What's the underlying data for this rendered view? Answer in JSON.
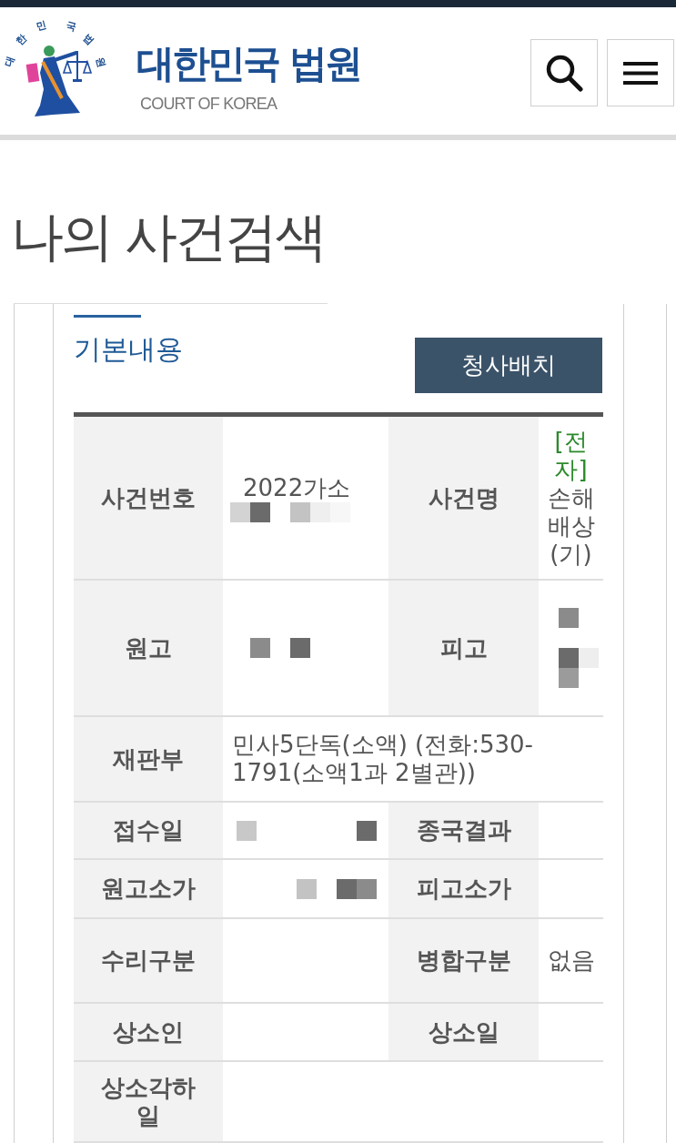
{
  "header": {
    "emblem_text": "대한민국법원",
    "title": "대한민국 법원",
    "subtitle": "COURT OF KOREA"
  },
  "page_title": "나의 사건검색",
  "section": {
    "title": "기본내용",
    "button": "청사배치"
  },
  "table": {
    "rows": [
      {
        "cells": [
          {
            "kind": "header",
            "text": "사건번호"
          },
          {
            "kind": "redacted",
            "text": "2022가소"
          },
          {
            "kind": "header",
            "text": "사건명"
          },
          {
            "kind": "value",
            "tag": "[전자]",
            "text": "손해배상(기)"
          }
        ]
      },
      {
        "cells": [
          {
            "kind": "header",
            "text": "원고"
          },
          {
            "kind": "redacted"
          },
          {
            "kind": "header",
            "text": "피고"
          },
          {
            "kind": "redacted"
          }
        ]
      },
      {
        "cells": [
          {
            "kind": "header",
            "text": "재판부"
          },
          {
            "kind": "value",
            "text": "민사5단독(소액) (전화:530-1791(소액1과 2별관))"
          }
        ]
      },
      {
        "cells": [
          {
            "kind": "header",
            "text": "접수일"
          },
          {
            "kind": "redacted"
          },
          {
            "kind": "header",
            "text": "종국결과"
          },
          {
            "kind": "value"
          }
        ]
      },
      {
        "cells": [
          {
            "kind": "header",
            "text": "원고소가"
          },
          {
            "kind": "redacted"
          },
          {
            "kind": "header",
            "text": "피고소가"
          },
          {
            "kind": "value"
          }
        ]
      },
      {
        "cells": [
          {
            "kind": "header",
            "text": "수리구분"
          },
          {
            "kind": "value"
          },
          {
            "kind": "header",
            "text": "병합구분"
          },
          {
            "kind": "value",
            "text": "없음"
          }
        ]
      },
      {
        "cells": [
          {
            "kind": "header",
            "text": "상소인"
          },
          {
            "kind": "value"
          },
          {
            "kind": "header",
            "text": "상소일"
          },
          {
            "kind": "value"
          }
        ]
      },
      {
        "cells": [
          {
            "kind": "header",
            "text": "상소각하일"
          },
          {
            "kind": "value"
          }
        ]
      }
    ]
  }
}
